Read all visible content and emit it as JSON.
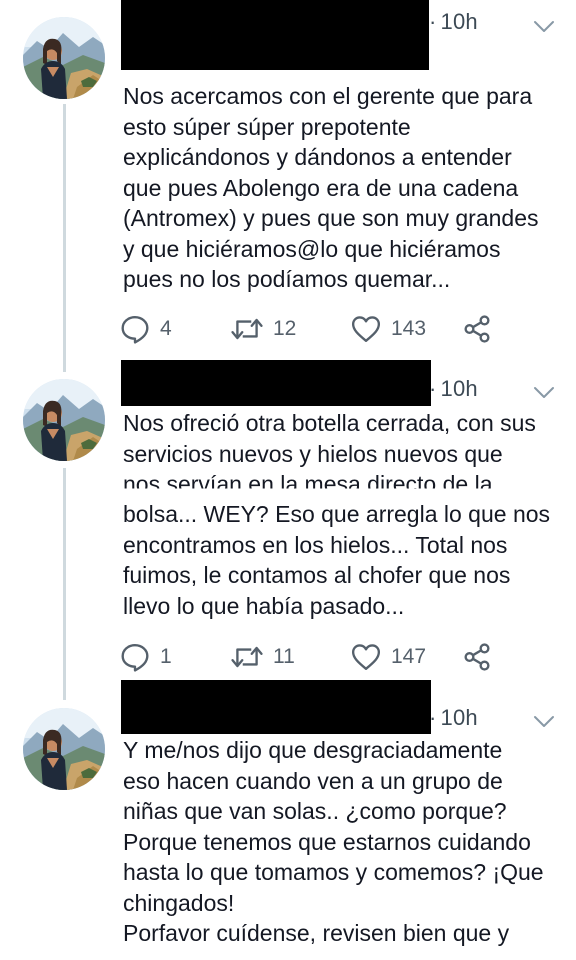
{
  "tweets": [
    {
      "time": "10h",
      "dot": "·",
      "text": "Nos acercamos con el gerente que para\nesto súper súper prepotente\nexplicándonos y dándonos a entender\nque pues Abolengo era de una cadena\n(Antromex) y pues que son muy grandes\ny que hiciéramos@lo que hiciéramos\npues no los podíamos quemar...",
      "replies": "4",
      "retweets": "12",
      "likes": "143"
    },
    {
      "time": "10h",
      "dot": "·",
      "text_top": "Nos ofreció otra botella cerrada, con sus\nservicios nuevos y hielos nuevos que",
      "garbled": "nos servían en la mesa directo de la",
      "text_bottom": "bolsa... WEY? Eso que arregla lo que nos\nencontramos en los hielos... Total nos\nfuimos, le contamos al chofer que nos\nllevo lo que había pasado...",
      "replies": "1",
      "retweets": "11",
      "likes": "147"
    },
    {
      "time": "10h",
      "dot": "·",
      "text": "Y me/nos dijo que desgraciadamente\neso hacen cuando ven a un grupo de\nniñas que van solas.. ¿como porque?\nPorque tenemos que estarnos cuidando\nhasta lo que tomamos y comemos? ¡Que\nchingados!\nPorfavor cuídense, revisen bien que y"
    }
  ],
  "icons": {
    "reply": "reply-icon",
    "retweet": "retweet-icon",
    "like": "heart-icon",
    "share": "share-icon",
    "more": "chevron-down-icon"
  },
  "colors": {
    "text": "#141823",
    "muted": "#55606b",
    "thread_line": "#cfd9de",
    "redaction": "#000000"
  }
}
